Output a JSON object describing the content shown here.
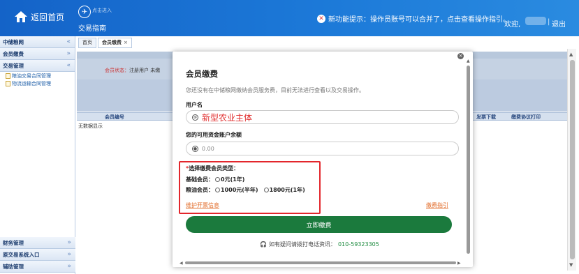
{
  "header": {
    "home_label": "返回首页",
    "guide_sub": "点击进入",
    "guide_label": "交易指南",
    "notice": "新功能提示：操作员账号可以合并了，点击查看操作指引。",
    "welcome": "欢迎,",
    "separator": "|",
    "logout": "退出"
  },
  "sidebar": {
    "title": "中储粮网",
    "sections": [
      {
        "label": "会员缴费",
        "chevron": "»"
      },
      {
        "label": "交易管理",
        "chevron": "«"
      }
    ],
    "items": [
      {
        "label": "粮油交易合同管理"
      },
      {
        "label": "物流运输合同管理"
      }
    ],
    "bottom": [
      {
        "label": "财务管理"
      },
      {
        "label": "原交易系统入口"
      },
      {
        "label": "辅助管理"
      }
    ]
  },
  "tabs": [
    {
      "label": "首页"
    },
    {
      "label": "会员缴费",
      "close": "×"
    }
  ],
  "main": {
    "status_label": "会员状态：",
    "status_value": "注册用户 未缴",
    "columns": {
      "col1": "会员编号",
      "col2": "发票下载",
      "col3": "缴费协议打印"
    },
    "empty": "无数据显示"
  },
  "modal": {
    "close": "×",
    "title": "会员缴费",
    "desc": "您还没有在中储粮网缴纳会员服务费，目前无法进行查看以及交易操作。",
    "user_label": "用户名",
    "user_value": "新型农业主体",
    "balance_label": "您的可用资金账户余额",
    "balance_value": "0.00",
    "type_star": "*",
    "type_title": "选择缴费会员类型：",
    "basic_label": "基础会员：",
    "basic_option": "0元(1年)",
    "grain_label": "粮油会员：",
    "grain_option1": "1000元(半年)",
    "grain_option2": "1800元(1年)",
    "invoice_link": "维护开票信息",
    "guide_link": "缴费指引",
    "pay_button": "立即缴费",
    "phone_text": "如有疑问请拨打电话资讯：",
    "phone_number": "010-59323305"
  },
  "colors": {
    "header": "#1c79d8",
    "pay_button": "#1b7a3d",
    "highlight_box": "#e3262c",
    "link": "#e26d2b"
  }
}
